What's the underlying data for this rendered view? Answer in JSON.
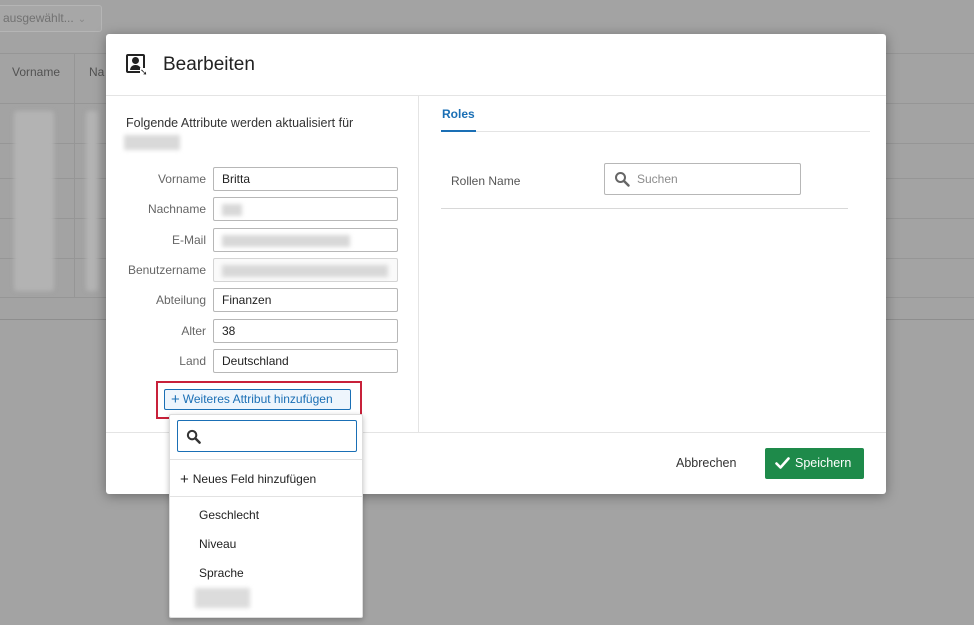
{
  "background": {
    "select_text": "ausgewählt...",
    "columns": [
      "Vorname",
      "Na"
    ]
  },
  "dialog": {
    "title": "Bearbeiten",
    "intro": "Folgende Attribute werden aktualisiert für",
    "fields": [
      {
        "label": "Vorname",
        "value": "Britta"
      },
      {
        "label": "Nachname",
        "value": ""
      },
      {
        "label": "E-Mail",
        "value": ""
      },
      {
        "label": "Benutzername",
        "value": ""
      },
      {
        "label": "Abteilung",
        "value": "Finanzen"
      },
      {
        "label": "Alter",
        "value": "38"
      },
      {
        "label": "Land",
        "value": "Deutschland"
      }
    ],
    "add_attribute_label": "Weiteres Attribut hinzufügen",
    "tabs": [
      "Roles"
    ],
    "roles": {
      "label": "Rollen Name",
      "search_placeholder": "Suchen"
    },
    "footer": {
      "cancel_label": "Abbrechen",
      "save_label": "Speichern"
    }
  },
  "dropdown": {
    "search_value": "",
    "new_field_label": "Neues Feld hinzufügen",
    "options": [
      "Geschlecht",
      "Niveau",
      "Sprache"
    ]
  },
  "colors": {
    "accent": "#1a6fb5",
    "save": "#1e8a4a",
    "highlight": "#c8213a"
  }
}
